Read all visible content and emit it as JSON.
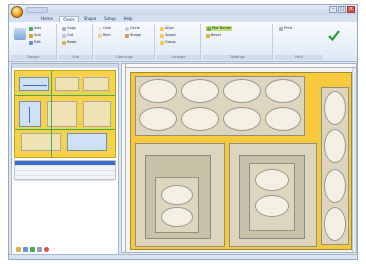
{
  "window": {
    "title": "",
    "minimize": "–",
    "maximize": "□",
    "close": "×"
  },
  "tabs": [
    {
      "label": "Home"
    },
    {
      "label": "Ovals"
    },
    {
      "label": "Shape"
    },
    {
      "label": "Setup"
    },
    {
      "label": "Help"
    }
  ],
  "ribbon": {
    "groups": [
      {
        "label": "Design"
      },
      {
        "label": "Grid"
      },
      {
        "label": "Openings"
      },
      {
        "label": "Arrange"
      },
      {
        "label": "Settings"
      },
      {
        "label": "Print"
      }
    ],
    "items": {
      "g1a": "Add",
      "g1b": "Sub",
      "g1c": "Edit",
      "g2a": "Copy",
      "g2b": "Cut",
      "g2c": "Paste",
      "g3a": "Oval",
      "g3b": "Rect",
      "g3c": "Circle",
      "g3d": "Shape",
      "g4a": "Align",
      "g4b": "Space",
      "g4c": "Group",
      "g5a": "Mat Border",
      "g5b": "Bevel",
      "print_label": "Print"
    }
  },
  "left_panel": {
    "rows": [
      {
        "text": "",
        "selected": true
      },
      {
        "text": "",
        "selected": false
      },
      {
        "text": "",
        "selected": false
      },
      {
        "text": "",
        "selected": false
      }
    ]
  },
  "status": {
    "text": ""
  },
  "colors": {
    "board": "#f7ca3e",
    "selection": "#3b6bc9",
    "accent_green": "#3fb04f",
    "close_button": "#d9554a"
  }
}
